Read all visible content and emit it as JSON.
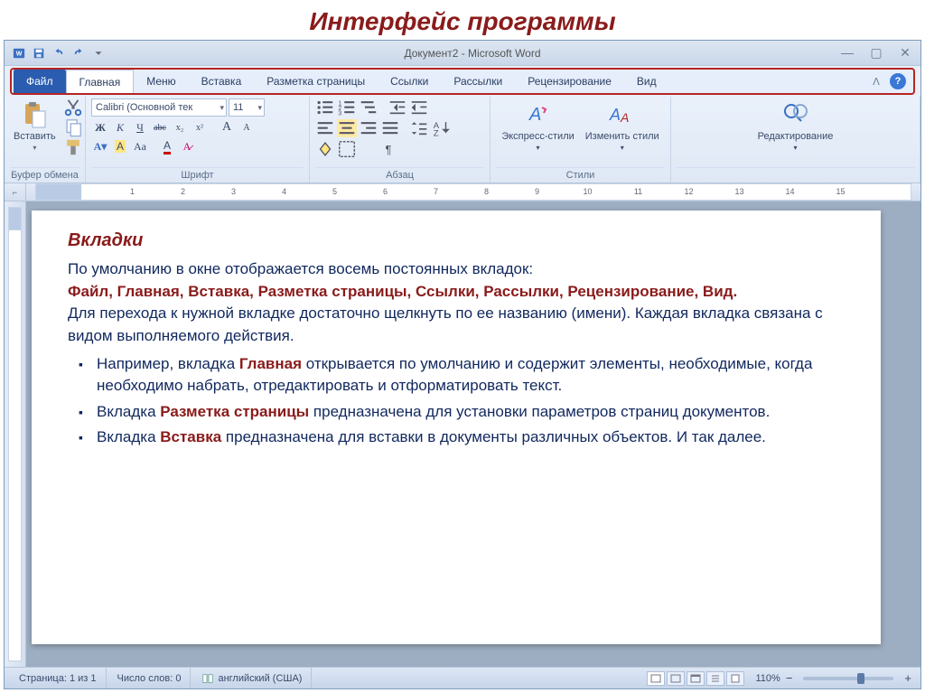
{
  "page_heading": "Интерфейс программы",
  "titlebar": {
    "title": "Документ2 - Microsoft Word"
  },
  "tabs": {
    "file": "Файл",
    "items": [
      "Главная",
      "Меню",
      "Вставка",
      "Разметка страницы",
      "Ссылки",
      "Рассылки",
      "Рецензирование",
      "Вид"
    ]
  },
  "ribbon": {
    "clipboard": {
      "paste": "Вставить",
      "label": "Буфер обмена"
    },
    "font": {
      "name": "Calibri (Основной тек",
      "size": "11",
      "label": "Шрифт",
      "bold": "Ж",
      "italic": "К",
      "underline": "Ч",
      "strike": "abc",
      "sub": "x₂",
      "sup": "x²",
      "grow": "A",
      "shrink": "A",
      "case": "Aa",
      "clear": "A",
      "highlight": "A",
      "color": "A"
    },
    "paragraph": {
      "label": "Абзац"
    },
    "styles": {
      "quick": "Экспресс-стили",
      "change": "Изменить стили",
      "label": "Стили"
    },
    "editing": {
      "label": "Редактирование"
    }
  },
  "document": {
    "heading": "Вкладки",
    "p1_a": "По умолчанию в окне отображается восемь постоянных вкладок:",
    "p1_b_list": "Файл,   Главная,   Вставка,   Разметка страницы,   Ссылки,   Рассылки,   Рецензирование,   Вид.",
    "p2": "Для перехода к нужной вкладке достаточно щелкнуть по ее названию (имени). Каждая вкладка связана с видом выполняемого действия.",
    "li1_a": "Например, вкладка ",
    "li1_b": "Главная",
    "li1_c": " открывается по умолчанию  и содержит элементы, необходимые, когда необходимо набрать, отредактировать и отформатировать текст.",
    "li2_a": "Вкладка ",
    "li2_b": "Разметка страницы",
    "li2_c": " предназначена для установки параметров страниц документов.",
    "li3_a": " Вкладка ",
    "li3_b": "Вставка",
    "li3_c": " предназначена для вставки в документы различных объектов. И так далее."
  },
  "status": {
    "page": "Страница: 1 из 1",
    "words": "Число слов: 0",
    "lang": "английский (США)",
    "zoom": "110%"
  },
  "ruler_ticks": [
    "1",
    "2",
    "3",
    "4",
    "5",
    "6",
    "7",
    "8",
    "9",
    "10",
    "11",
    "12",
    "13",
    "14",
    "15"
  ]
}
